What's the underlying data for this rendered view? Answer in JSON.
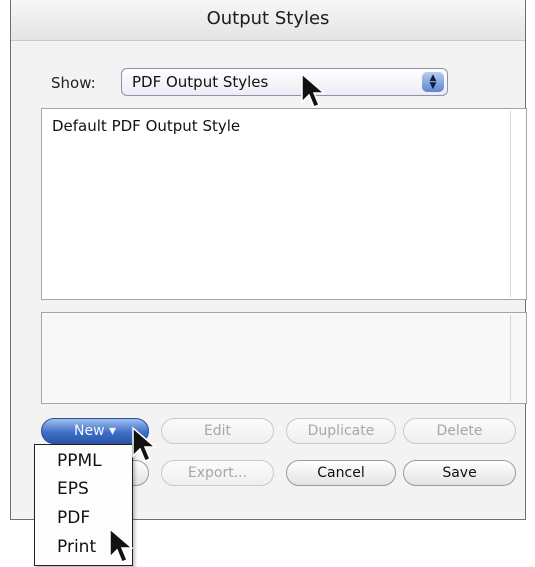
{
  "window": {
    "title": "Output Styles"
  },
  "show": {
    "label": "Show:",
    "selected": "PDF Output Styles"
  },
  "styles_list": {
    "items": [
      "Default PDF Output Style"
    ]
  },
  "buttons": {
    "new": "New",
    "new_arrow": "▾",
    "edit": "Edit",
    "duplicate": "Duplicate",
    "delete": "Delete",
    "export": "Export...",
    "cancel": "Cancel",
    "save": "Save"
  },
  "new_menu": {
    "items": [
      "PPML",
      "EPS",
      "PDF",
      "Print"
    ]
  },
  "icons": {
    "cursor": "arrow-cursor-icon",
    "popup_arrows": "up-down-arrows-icon"
  },
  "colors": {
    "accent": "#3f6fc7"
  }
}
